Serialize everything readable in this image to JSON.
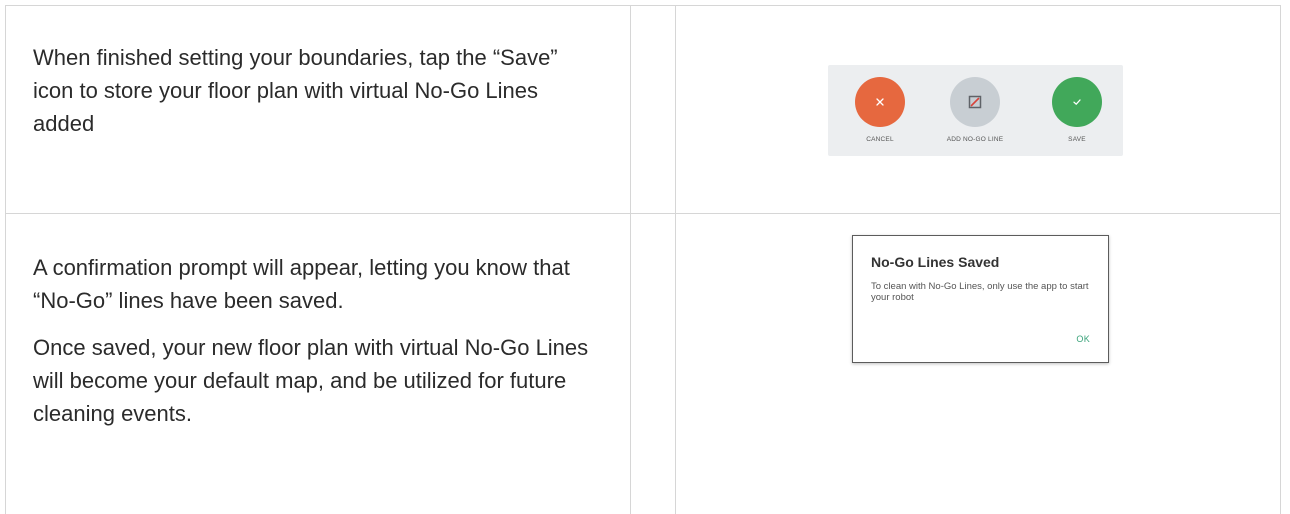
{
  "rows": [
    {
      "text": "When finished setting your boundaries, tap the “Save” icon to store your floor plan with virtual No-Go Lines added",
      "toolbar": {
        "cancel_label": "CANCEL",
        "add_label": "ADD NO-GO LINE",
        "save_label": "SAVE"
      }
    },
    {
      "paragraphs": [
        "A confirmation prompt will appear, letting you know that “No-Go” lines have been saved.",
        "Once saved, your new floor plan with virtual No-Go Lines will become your default map, and be utilized for future cleaning events."
      ],
      "dialog": {
        "title": "No-Go Lines Saved",
        "body": "To clean with No-Go Lines, only use the app to start your robot",
        "ok_label": "OK"
      }
    }
  ],
  "colors": {
    "cancel": "#e6683f",
    "add": "#c8ced3",
    "save": "#41a85a",
    "ok_text": "#3aa37a",
    "grid": "#d6d6d6"
  },
  "icons": [
    "close-icon",
    "no-go-line-icon",
    "check-icon"
  ]
}
